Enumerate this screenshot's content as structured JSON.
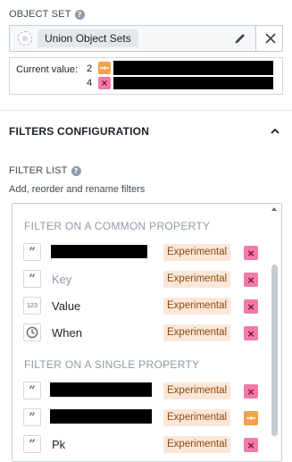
{
  "object_set": {
    "label": "OBJECT SET",
    "tag": "Union Object Sets",
    "current_value_label": "Current value:",
    "current_values": [
      {
        "count": "2",
        "icon": "plus-box-orange"
      },
      {
        "count": "4",
        "icon": "x-box-pink"
      }
    ]
  },
  "filters_configuration": {
    "title": "FILTERS CONFIGURATION"
  },
  "filter_list": {
    "label": "FILTER LIST",
    "description": "Add, reorder and rename filters",
    "groups": [
      {
        "title": "FILTER ON A COMMON PROPERTY",
        "items": [
          {
            "icon": "quote-icon",
            "label": "",
            "badge": "Experimental",
            "action": "remove"
          },
          {
            "icon": "quote-icon",
            "label": "Key",
            "badge": "Experimental",
            "action": "remove"
          },
          {
            "icon": "number-icon",
            "icon_text": "123",
            "label": "Value",
            "badge": "Experimental",
            "action": "remove"
          },
          {
            "icon": "clock-icon",
            "label": "When",
            "badge": "Experimental",
            "action": "remove"
          }
        ]
      },
      {
        "title": "FILTER ON A SINGLE PROPERTY",
        "items": [
          {
            "icon": "quote-icon",
            "label": "",
            "badge": "Experimental",
            "action": "remove"
          },
          {
            "icon": "quote-icon",
            "label": "",
            "badge": "Experimental",
            "action": "add"
          },
          {
            "icon": "quote-icon",
            "label": "Pk",
            "badge": "Experimental",
            "action": "remove"
          }
        ]
      }
    ]
  },
  "colors": {
    "badge_bg": "#fbe7d9",
    "remove_action": "#f07aa8",
    "add_action": "#f0a24a"
  }
}
